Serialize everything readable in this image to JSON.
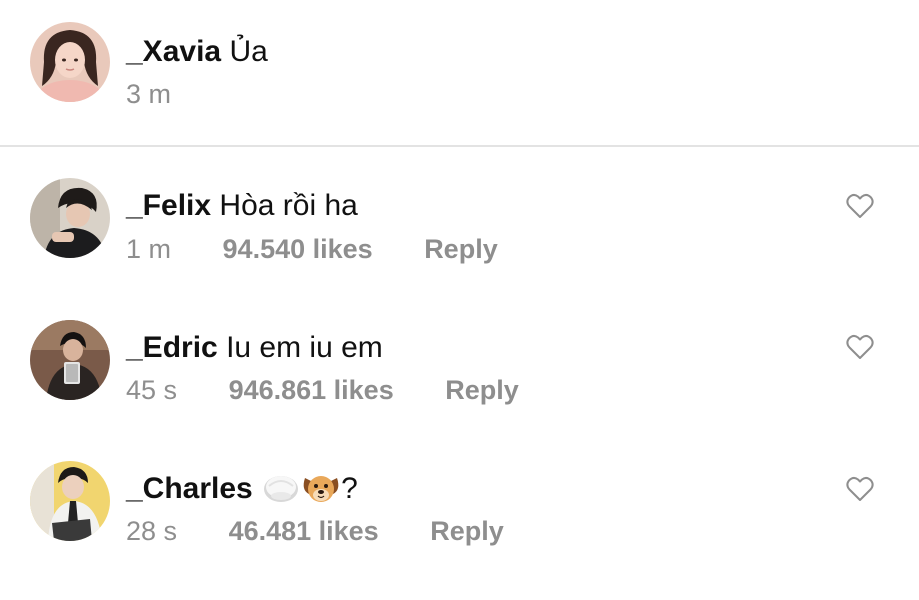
{
  "caption": {
    "username": "_Xavia",
    "text": "Ủa",
    "time": "3 m"
  },
  "comments": [
    {
      "username": "_Felix",
      "text": "Hòa rồi ha",
      "time": "1 m",
      "likes": "94.540 likes",
      "reply": "Reply"
    },
    {
      "username": "_Edric",
      "text": "Iu em iu em",
      "time": "45 s",
      "likes": "946.861 likes",
      "reply": "Reply"
    },
    {
      "username": "_Charles",
      "text": "?",
      "emojis": [
        "rice-ball-emoji",
        "dog-face-emoji"
      ],
      "time": "28 s",
      "likes": "46.481 likes",
      "reply": "Reply"
    }
  ],
  "colors": {
    "meta": "#8e8e8e",
    "divider": "#e3e3e3",
    "text": "#111111"
  }
}
